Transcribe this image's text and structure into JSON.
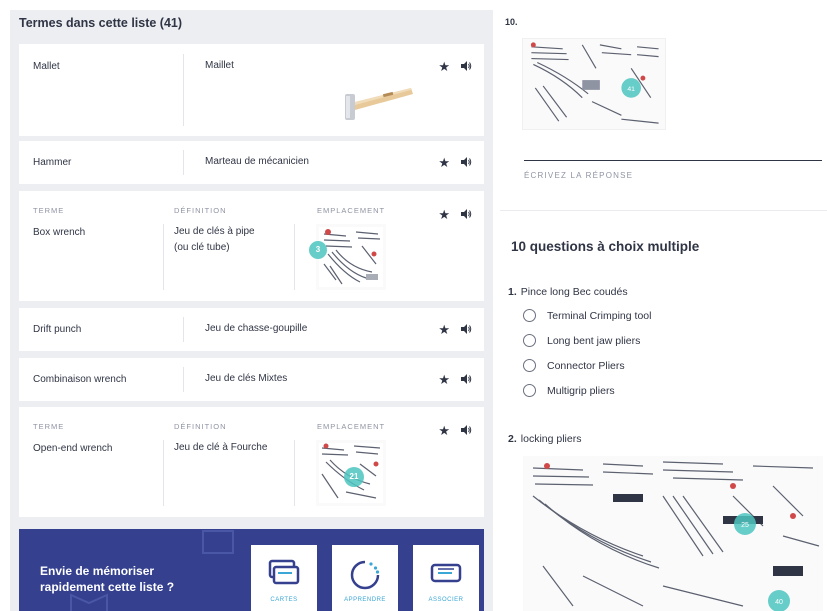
{
  "list": {
    "title": "Termes dans cette liste (41)",
    "headers": {
      "term": "TERME",
      "definition": "DÉFINITION",
      "location": "EMPLACEMENT"
    },
    "items": [
      {
        "term": "Mallet",
        "definition": "Maillet",
        "image": "hammer-image"
      },
      {
        "term": "Hammer",
        "definition": "Marteau de mécanicien"
      },
      {
        "term": "Box wrench",
        "definition_line1": "Jeu de clés à pipe",
        "definition_line2": "(ou clé tube)",
        "location_badge": "3"
      },
      {
        "term": "Drift punch",
        "definition": "Jeu de chasse-goupille"
      },
      {
        "term": "Combinaison wrench",
        "definition": "Jeu de clés Mixtes"
      },
      {
        "term": "Open-end wrench",
        "definition": "Jeu de clé à Fourche",
        "location_badge": "21"
      }
    ],
    "star_icon": "star-icon",
    "audio_icon": "speaker-icon"
  },
  "promo": {
    "text": "Envie de mémoriser rapidement cette liste ?",
    "buttons": [
      {
        "label": "CARTES",
        "icon": "cards-icon"
      },
      {
        "label": "APPRENDRE",
        "icon": "learn-icon"
      },
      {
        "label": "ASSOCIER",
        "icon": "match-icon"
      }
    ]
  },
  "quiz": {
    "q10": {
      "number": "10.",
      "answer_placeholder": "ÉCRIVEZ LA RÉPONSE",
      "image_badge": "41"
    },
    "section_title": "10 questions à choix multiple",
    "q1": {
      "number": "1.",
      "prompt": "Pince long Bec coudés",
      "options": [
        "Terminal Crimping tool",
        "Long bent jaw pliers",
        "Connector Pliers",
        "Multigrip pliers"
      ]
    },
    "q2": {
      "number": "2.",
      "prompt": "locking pliers",
      "image_badges": [
        "25",
        "40"
      ]
    }
  },
  "colors": {
    "panel_bg": "#eceef1",
    "promo_bg": "#35418f",
    "accent": "#3aa7d6",
    "badge_teal": "#4cc4c0"
  }
}
